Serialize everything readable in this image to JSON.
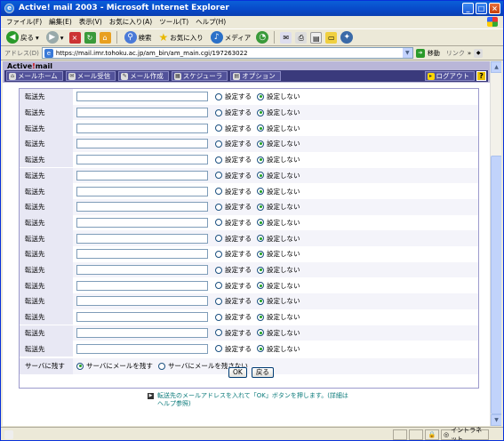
{
  "window": {
    "title": "Active! mail 2003 - Microsoft Internet Explorer"
  },
  "menu": [
    "ファイル(F)",
    "編集(E)",
    "表示(V)",
    "お気に入り(A)",
    "ツール(T)",
    "ヘルプ(H)"
  ],
  "toolbar": {
    "back": "戻る",
    "search": "検索",
    "favorites": "お気に入り",
    "media": "メディア"
  },
  "address": {
    "label": "アドレス(D)",
    "url": "https://mail.imr.tohoku.ac.jp/am_bin/am_main.cgi/197263022",
    "go": "移動",
    "links": "リンク"
  },
  "app": {
    "logo_a": "Active",
    "logo_slash": "!",
    "logo_b": "mail",
    "nav": {
      "home": "メールホーム",
      "receive": "メール受信",
      "compose": "メール作成",
      "schedule": "スケジューラ",
      "option": "オプション",
      "logout": "ログアウト",
      "help": "?"
    }
  },
  "form": {
    "forward_label": "転送先",
    "opt_set": "設定する",
    "opt_unset": "設定しない",
    "forward_row_count": 17,
    "server_label": "サーバに残す",
    "server_keep": "サーバにメールを残す",
    "server_nokeep": "サーバにメールを残さない",
    "ok": "OK",
    "back": "戻る",
    "hint": "転送先のメールアドレスを入れて「OK」ボタンを押します。(詳細はヘルプ参照)"
  },
  "status": {
    "zone": "イントラネット"
  }
}
